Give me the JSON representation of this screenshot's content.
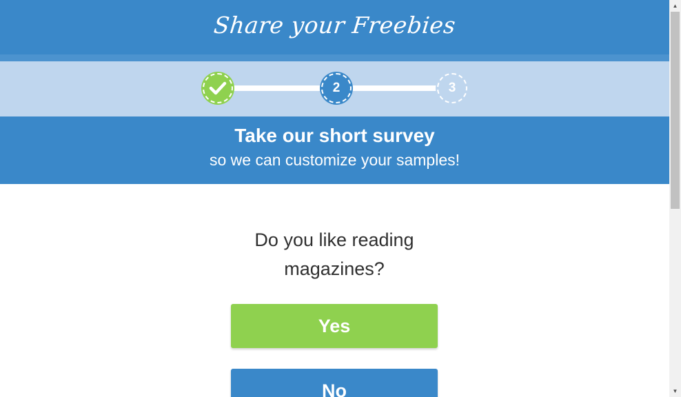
{
  "header": {
    "logo_text": "Share your Freebies",
    "color": "#3a88c9"
  },
  "progress": {
    "current_step": 2,
    "total_steps": 3,
    "steps": [
      {
        "label": "",
        "state": "completed",
        "icon": "check-icon",
        "color": "#8fd14f"
      },
      {
        "label": "2",
        "state": "current",
        "color": "#3a88c9"
      },
      {
        "label": "3",
        "state": "upcoming",
        "color": "#bfd6ee"
      }
    ]
  },
  "banner": {
    "title": "Take our short survey",
    "subtitle": "so we can customize your samples!"
  },
  "survey": {
    "question": "Do you like reading magazines?",
    "yes_label": "Yes",
    "no_label": "No",
    "yes_color": "#8fd14f",
    "no_color": "#3a88c9"
  },
  "scrollbar": {
    "up_icon": "scroll-up-arrow-icon",
    "down_icon": "scroll-down-arrow-icon"
  }
}
